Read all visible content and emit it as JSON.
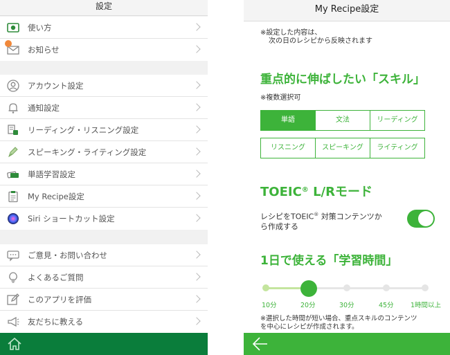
{
  "left": {
    "title": "設定",
    "group1": [
      {
        "label": "使い方",
        "icon": "video-icon"
      },
      {
        "label": "お知らせ",
        "icon": "mail-icon"
      }
    ],
    "group2": [
      {
        "label": "アカウント設定",
        "icon": "user-icon"
      },
      {
        "label": "通知設定",
        "icon": "bell-icon"
      },
      {
        "label": "リーディング・リスニング設定",
        "icon": "reading-icon"
      },
      {
        "label": "スピーキング・ライティング設定",
        "icon": "pen-icon"
      },
      {
        "label": "単語学習設定",
        "icon": "card-icon"
      },
      {
        "label": "My Recipe設定",
        "icon": "clipboard-icon"
      },
      {
        "label": "Siri ショートカット設定",
        "icon": "siri-icon"
      }
    ],
    "group3": [
      {
        "label": "ご意見・お問い合わせ",
        "icon": "chat-icon"
      },
      {
        "label": "よくあるご質問",
        "icon": "bulb-icon"
      },
      {
        "label": "このアプリを評価",
        "icon": "edit-icon"
      },
      {
        "label": "友だちに教える",
        "icon": "megaphone-icon"
      }
    ],
    "footer_icon": "home-icon"
  },
  "right": {
    "title": "My Recipe設定",
    "note_line1": "※設定した内容は、",
    "note_line2": "次の日のレシピから反映されます",
    "skills_title": "重点的に伸ばしたい「スキル」",
    "skills_note": "※複数選択可",
    "skills": [
      {
        "label": "単語",
        "selected": true
      },
      {
        "label": "文法",
        "selected": false
      },
      {
        "label": "リーディング",
        "selected": false
      },
      {
        "label": "リスニング",
        "selected": false
      },
      {
        "label": "スピーキング",
        "selected": false
      },
      {
        "label": "ライティング",
        "selected": false
      }
    ],
    "toeic_title_a": "TOEIC",
    "toeic_title_mark": "®",
    "toeic_title_b": " L/Rモード",
    "toeic_label_a": "レシピをTOEIC",
    "toeic_label_mark": "®",
    "toeic_label_b": " 対策コンテンツか",
    "toeic_label_c": "ら作成する",
    "toeic_on": true,
    "time_title": "1日で使える「学習時間」",
    "time_options": [
      "10分",
      "20分",
      "30分",
      "45分",
      "1時間以上"
    ],
    "time_selected_index": 1,
    "time_note_line1": "※選択した時間が短い場合、重点スキルのコンテンツ",
    "time_note_line2": "を中心にレシピが作成されます。",
    "footer_icon": "back-arrow-icon"
  },
  "colors": {
    "accent": "#3db33a",
    "dark_green": "#0a7d3b",
    "badge": "#f0883a"
  }
}
